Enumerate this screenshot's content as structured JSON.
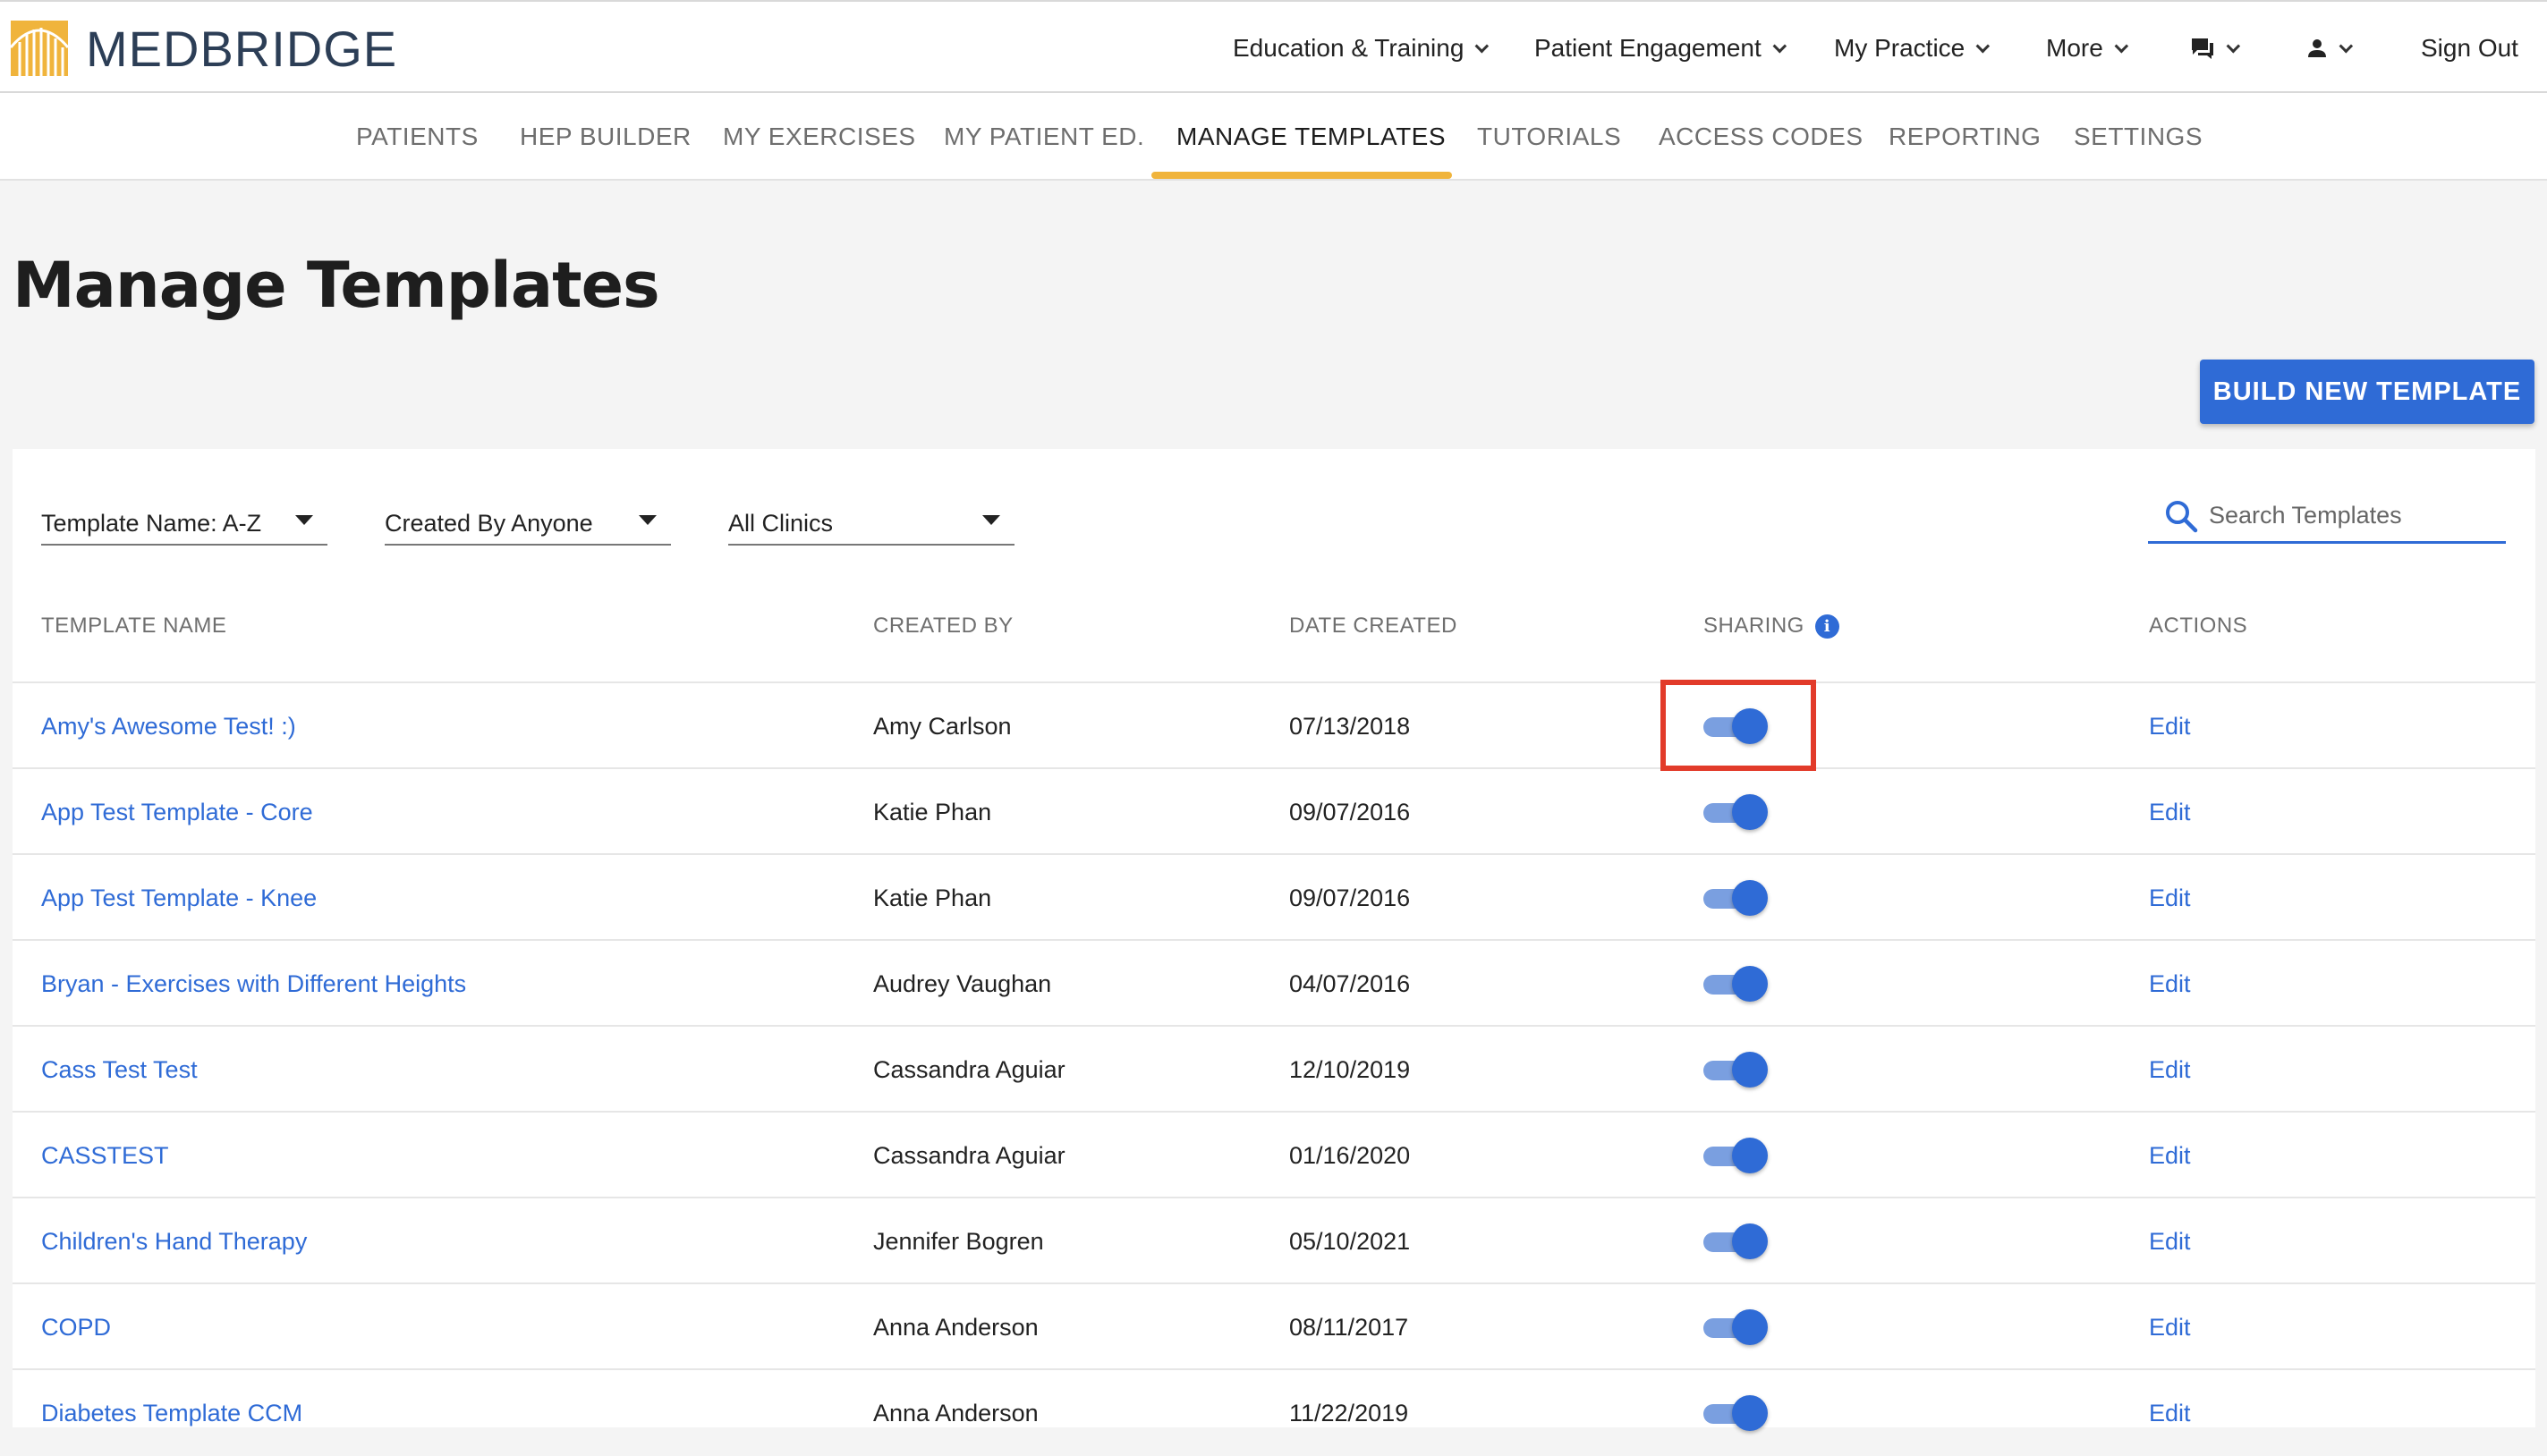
{
  "brand": {
    "name": "MEDBRIDGE",
    "colors": {
      "gold": "#f0b43c",
      "navy": "#2c3e56",
      "accent": "#2f6bd6",
      "highlight": "#e23b2a"
    }
  },
  "topnav": {
    "items": [
      {
        "label": "Education & Training"
      },
      {
        "label": "Patient Engagement"
      },
      {
        "label": "My Practice"
      },
      {
        "label": "More"
      }
    ],
    "messages_icon": "chat-bubble-icon",
    "account_icon": "person-icon",
    "sign_out": "Sign Out"
  },
  "subnav": {
    "tabs": [
      {
        "label": "PATIENTS"
      },
      {
        "label": "HEP BUILDER"
      },
      {
        "label": "MY EXERCISES"
      },
      {
        "label": "MY PATIENT ED."
      },
      {
        "label": "MANAGE TEMPLATES",
        "active": true
      },
      {
        "label": "TUTORIALS"
      },
      {
        "label": "ACCESS CODES"
      },
      {
        "label": "REPORTING"
      },
      {
        "label": "SETTINGS"
      }
    ]
  },
  "page": {
    "title": "Manage Templates",
    "build_button": "BUILD NEW TEMPLATE"
  },
  "filters": {
    "sort": "Template Name: A-Z",
    "created_by": "Created By Anyone",
    "clinics": "All Clinics",
    "search_placeholder": "Search Templates"
  },
  "table": {
    "headers": {
      "name": "TEMPLATE NAME",
      "created_by": "CREATED BY",
      "date": "DATE CREATED",
      "sharing": "SHARING",
      "actions": "ACTIONS"
    },
    "rows": [
      {
        "name": "Amy's Awesome Test! :)",
        "created_by": "Amy Carlson",
        "date": "07/13/2018",
        "sharing": true,
        "action": "Edit"
      },
      {
        "name": "App Test Template - Core",
        "created_by": "Katie Phan",
        "date": "09/07/2016",
        "sharing": true,
        "action": "Edit"
      },
      {
        "name": "App Test Template - Knee",
        "created_by": "Katie Phan",
        "date": "09/07/2016",
        "sharing": true,
        "action": "Edit"
      },
      {
        "name": "Bryan - Exercises with Different Heights",
        "created_by": "Audrey Vaughan",
        "date": "04/07/2016",
        "sharing": true,
        "action": "Edit"
      },
      {
        "name": "Cass Test Test",
        "created_by": "Cassandra Aguiar",
        "date": "12/10/2019",
        "sharing": true,
        "action": "Edit"
      },
      {
        "name": "CASSTEST",
        "created_by": "Cassandra Aguiar",
        "date": "01/16/2020",
        "sharing": true,
        "action": "Edit"
      },
      {
        "name": "Children's Hand Therapy",
        "created_by": "Jennifer Bogren",
        "date": "05/10/2021",
        "sharing": true,
        "action": "Edit"
      },
      {
        "name": "COPD",
        "created_by": "Anna Anderson",
        "date": "08/11/2017",
        "sharing": true,
        "action": "Edit"
      },
      {
        "name": "Diabetes Template CCM",
        "created_by": "Anna Anderson",
        "date": "11/22/2019",
        "sharing": true,
        "action": "Edit"
      }
    ]
  }
}
